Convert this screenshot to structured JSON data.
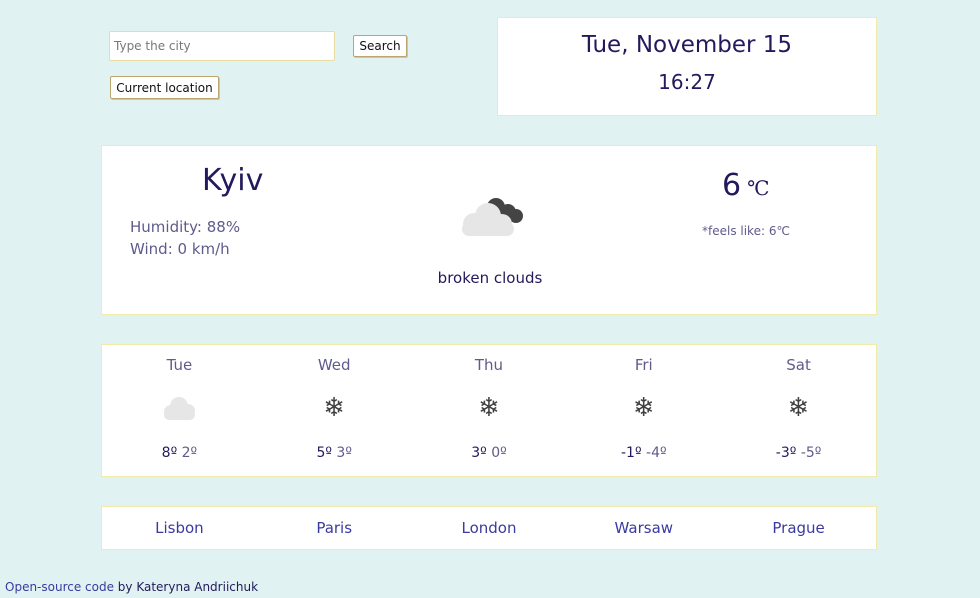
{
  "search": {
    "placeholder": "Type the city",
    "value": "",
    "search_label": "Search",
    "location_label": "Current location"
  },
  "datetime": {
    "date": "Tue, November 15",
    "time": "16:27"
  },
  "current": {
    "city": "Kyiv",
    "humidity": "Humidity: 88%",
    "wind": "Wind: 0 km/h",
    "icon": "broken-clouds-icon",
    "description": "broken clouds",
    "temperature": "6",
    "unit": "℃",
    "feels_like": "*feels like: 6℃"
  },
  "forecast": [
    {
      "day": "Tue",
      "icon": "cloud-icon",
      "max": "8º",
      "min": "2º"
    },
    {
      "day": "Wed",
      "icon": "snowflake-icon",
      "max": "5º",
      "min": "3º"
    },
    {
      "day": "Thu",
      "icon": "snowflake-icon",
      "max": "3º",
      "min": "0º"
    },
    {
      "day": "Fri",
      "icon": "snowflake-icon",
      "max": "-1º",
      "min": "-4º"
    },
    {
      "day": "Sat",
      "icon": "snowflake-icon",
      "max": "-3º",
      "min": "-5º"
    }
  ],
  "cities": [
    "Lisbon",
    "Paris",
    "London",
    "Warsaw",
    "Prague"
  ],
  "footer": {
    "link_text": "Open-source code",
    "author_text": " by Kateryna Andriichuk"
  },
  "colors": {
    "background": "#e0f2f1",
    "card_border": "#f2eaa8",
    "primary_text": "#221a5c",
    "secondary_text": "#5f5b8c",
    "link": "#3b3aa0"
  }
}
